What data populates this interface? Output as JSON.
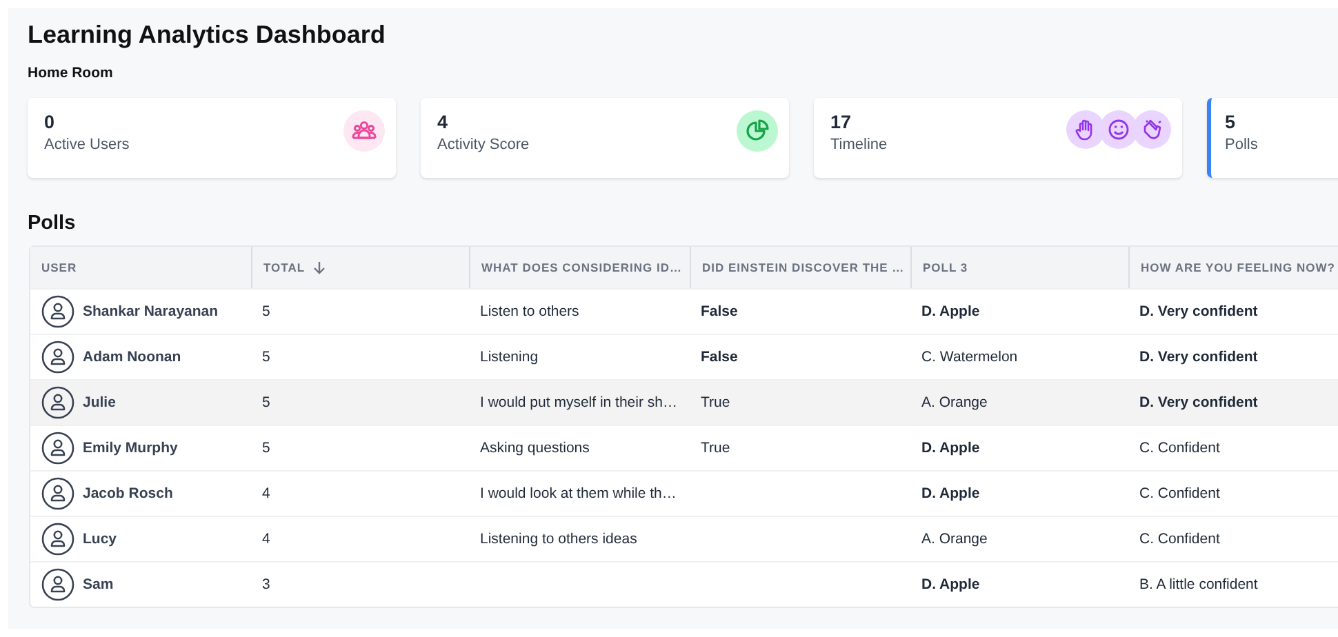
{
  "title": "Learning Analytics Dashboard",
  "room": "Home Room",
  "stats": [
    {
      "value": "0",
      "label": "Active Users",
      "kind": "users",
      "selected": false
    },
    {
      "value": "4",
      "label": "Activity Score",
      "kind": "score",
      "selected": false
    },
    {
      "value": "17",
      "label": "Timeline",
      "kind": "timeline",
      "selected": false
    },
    {
      "value": "5",
      "label": "Polls",
      "kind": "polls",
      "selected": true
    }
  ],
  "polls": {
    "title": "Polls",
    "columns": [
      {
        "label": "USER",
        "sorted": false
      },
      {
        "label": "TOTAL",
        "sorted": true
      },
      {
        "label": "WHAT DOES CONSIDERING ID…"
      },
      {
        "label": "DID EINSTEIN DISCOVER THE …"
      },
      {
        "label": "POLL 3",
        "sorted": false
      },
      {
        "label": "HOW ARE YOU FEELING NOW?"
      }
    ],
    "rows": [
      {
        "user": "Shankar Narayanan",
        "total": "5",
        "selected": false,
        "answer_1": {
          "text": "Listen to others",
          "bold": false
        },
        "answer_2": {
          "text": "False",
          "bold": true
        },
        "answer_3": {
          "text": "D. Apple",
          "bold": true
        },
        "answer_4": {
          "text": "D. Very confident",
          "bold": true
        }
      },
      {
        "user": "Adam Noonan",
        "total": "5",
        "selected": false,
        "answer_1": {
          "text": "Listening",
          "bold": false
        },
        "answer_2": {
          "text": "False",
          "bold": true
        },
        "answer_3": {
          "text": "C. Watermelon",
          "bold": false
        },
        "answer_4": {
          "text": "D. Very confident",
          "bold": true
        }
      },
      {
        "user": "Julie",
        "total": "5",
        "selected": true,
        "answer_1": {
          "text": "I would put myself in their sh…",
          "bold": false
        },
        "answer_2": {
          "text": "True",
          "bold": false
        },
        "answer_3": {
          "text": "A. Orange",
          "bold": false
        },
        "answer_4": {
          "text": "D. Very confident",
          "bold": true
        }
      },
      {
        "user": "Emily Murphy",
        "total": "5",
        "selected": false,
        "answer_1": {
          "text": "Asking questions",
          "bold": false
        },
        "answer_2": {
          "text": "True",
          "bold": false
        },
        "answer_3": {
          "text": "D. Apple",
          "bold": true
        },
        "answer_4": {
          "text": "C. Confident",
          "bold": false
        }
      },
      {
        "user": "Jacob Rosch",
        "total": "4",
        "selected": false,
        "answer_1": {
          "text": "I would look at them while th…",
          "bold": false
        },
        "answer_3": {
          "text": "D. Apple",
          "bold": true
        },
        "answer_4": {
          "text": "C. Confident",
          "bold": false
        }
      },
      {
        "user": "Lucy",
        "total": "4",
        "selected": false,
        "answer_1": {
          "text": "Listening to others ideas",
          "bold": false
        },
        "answer_3": {
          "text": "A. Orange",
          "bold": false
        },
        "answer_4": {
          "text": "C. Confident",
          "bold": false
        }
      },
      {
        "user": "Sam",
        "total": "3",
        "selected": false,
        "answer_3": {
          "text": "D. Apple",
          "bold": true
        },
        "answer_4": {
          "text": "B. A little confident",
          "bold": false
        }
      }
    ]
  }
}
